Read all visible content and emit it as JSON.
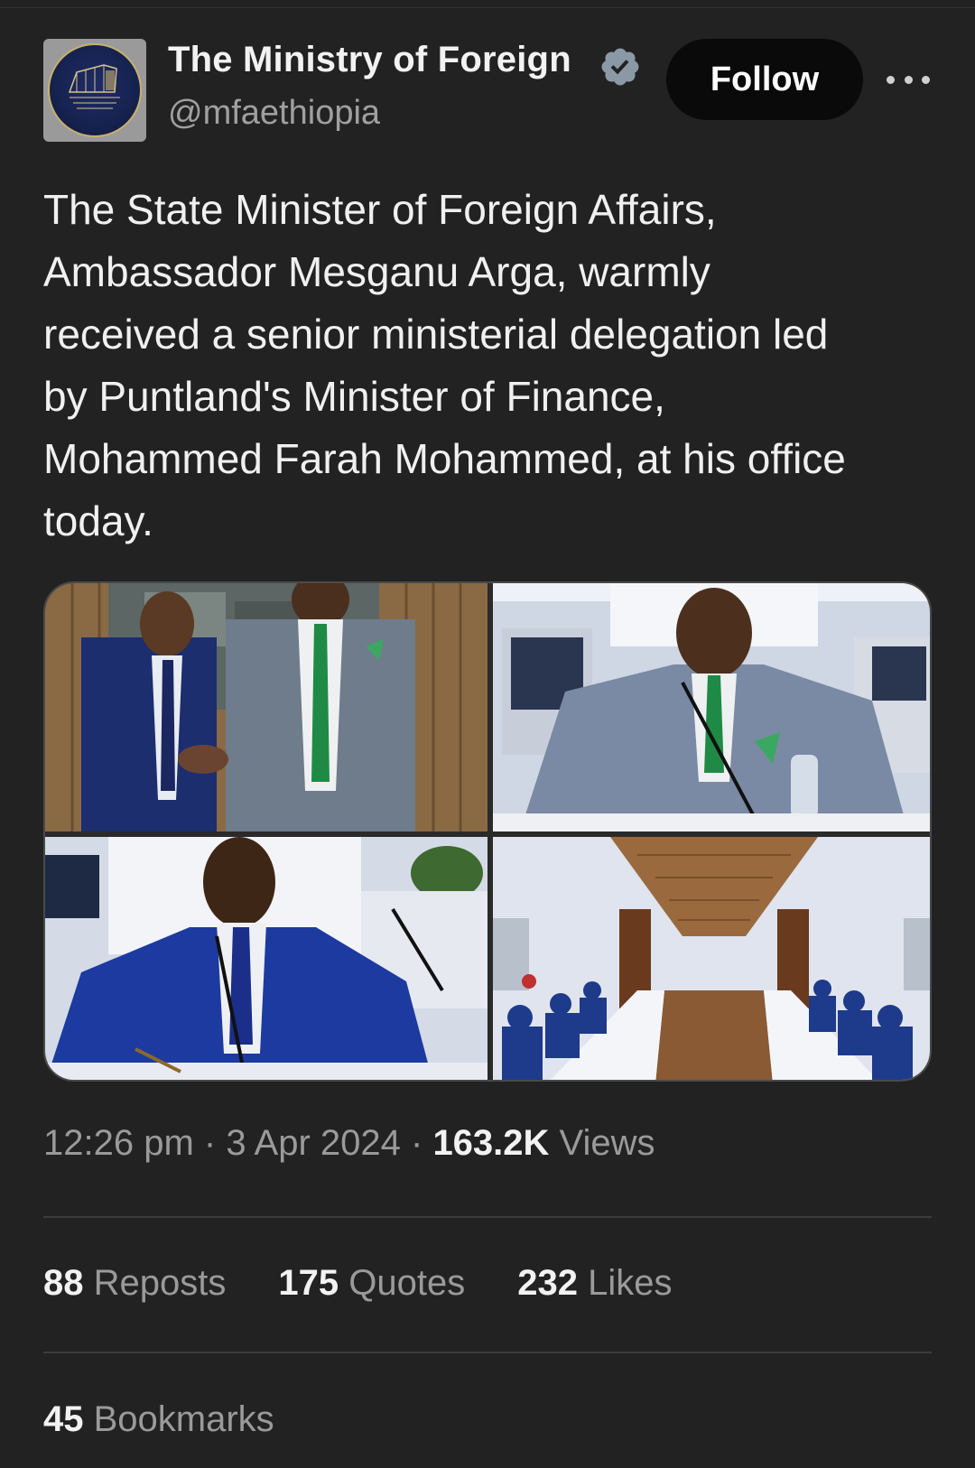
{
  "author": {
    "display_name": "The Ministry of Foreign",
    "handle": "@mfaethiopia",
    "verified_icon": "verified-badge-icon",
    "verified_color": "#8b98a5"
  },
  "actions": {
    "follow_label": "Follow",
    "more_icon": "more-horizontal-icon"
  },
  "tweet": {
    "text": "The State Minister of Foreign Affairs,\nAmbassador Mesganu Arga, warmly\nreceived a senior ministerial delegation led\nby Puntland's Minister of Finance,\nMohammed Farah Mohammed, at his office\ntoday."
  },
  "media": {
    "photos": [
      {
        "name": "handshake-photo"
      },
      {
        "name": "minister-seated-photo"
      },
      {
        "name": "finance-minister-signing-photo"
      },
      {
        "name": "meeting-room-photo"
      }
    ]
  },
  "meta": {
    "time": "12:26 pm",
    "separator": "·",
    "date": "3 Apr 2024",
    "views_count": "163.2K",
    "views_label": "Views"
  },
  "stats": {
    "reposts_count": "88",
    "reposts_label": "Reposts",
    "quotes_count": "175",
    "quotes_label": "Quotes",
    "likes_count": "232",
    "likes_label": "Likes",
    "bookmarks_count": "45",
    "bookmarks_label": "Bookmarks"
  },
  "colors": {
    "background": "#222222",
    "follow_button": "#0a0a0a",
    "secondary_text": "#9a9a9a"
  }
}
